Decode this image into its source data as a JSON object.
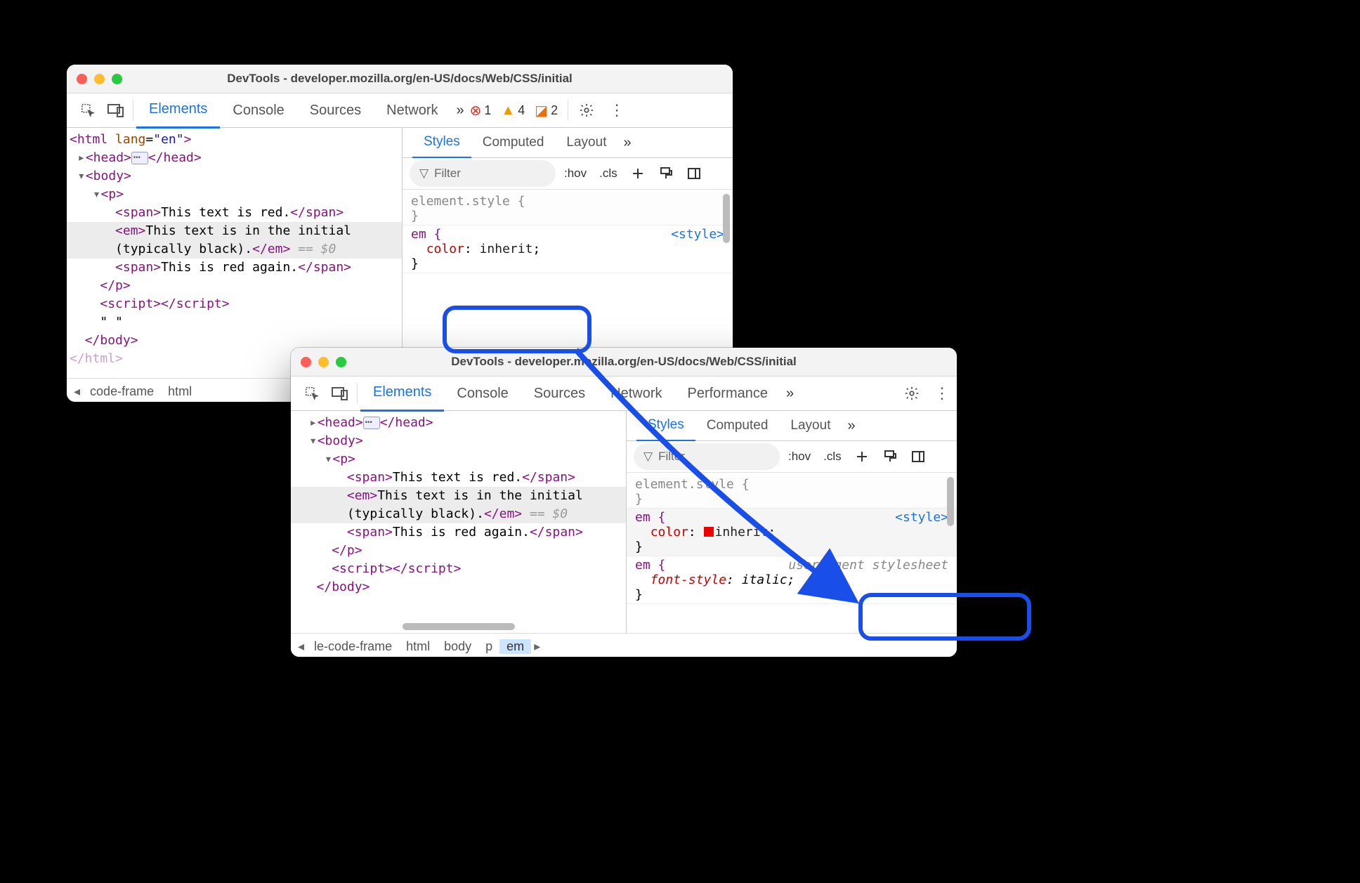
{
  "win1": {
    "title": "DevTools - developer.mozilla.org/en-US/docs/Web/CSS/initial",
    "tabs": {
      "elements": "Elements",
      "console": "Console",
      "sources": "Sources",
      "network": "Network"
    },
    "badges": {
      "errors": "1",
      "warnings": "4",
      "issues": "2"
    },
    "styles": {
      "tabs": {
        "styles": "Styles",
        "computed": "Computed",
        "layout": "Layout"
      },
      "filter": "Filter",
      "hov": ":hov",
      "cls": ".cls",
      "elementStyle": "element.style {",
      "closeBrace": "}",
      "emSelector": "em {",
      "colorProp": "color",
      "colorVal": "inherit",
      "styleLink": "<style>"
    },
    "dom": {
      "htmlOpen": "<html lang=\"en\">",
      "head": "<head>",
      "headClose": "</head>",
      "body": "<body>",
      "bodyClose": "</body>",
      "p": "<p>",
      "pClose": "</p>",
      "span1a": "<span>",
      "span1b": "This text is red.",
      "span1c": "</span>",
      "em1a": "<em>",
      "em1b": "This text is in the initial (typically black).",
      "em1c": "</em>",
      "dollarzero": " == $0",
      "span2a": "<span>",
      "span2b": "This is red again.",
      "span2c": "</span>",
      "script": "<script>",
      "scriptClose": "</script>",
      "quote": "\" \"",
      "htmlClose": "</html>"
    },
    "crumbs": {
      "a": "code-frame",
      "b": "html"
    }
  },
  "win2": {
    "title": "DevTools - developer.mozilla.org/en-US/docs/Web/CSS/initial",
    "tabs": {
      "elements": "Elements",
      "console": "Console",
      "sources": "Sources",
      "network": "Network",
      "performance": "Performance"
    },
    "styles": {
      "tabs": {
        "styles": "Styles",
        "computed": "Computed",
        "layout": "Layout"
      },
      "filter": "Filter",
      "hov": ":hov",
      "cls": ".cls",
      "elementStyle": "element.style {",
      "closeBrace": "}",
      "emSelector": "em {",
      "colorProp": "color",
      "colorVal": "inherit",
      "styleLink": "<style>",
      "uaSelector": "em {",
      "uaProp": "font-style",
      "uaVal": "italic",
      "uaSrc": "user agent stylesheet"
    },
    "dom": {
      "head": "<head>",
      "headClose": "</head>",
      "body": "<body>",
      "bodyClose": "</body>",
      "p": "<p>",
      "pClose": "</p>",
      "span1a": "<span>",
      "span1b": "This text is red.",
      "span1c": "</span>",
      "em1a": "<em>",
      "em1b": "This text is in the initial (typically black).",
      "em1c": "</em>",
      "dollarzero": " == $0",
      "span2a": "<span>",
      "span2b": "This is red again.",
      "span2c": "</span>",
      "script": "<script>",
      "scriptClose": "</script>"
    },
    "crumbs": {
      "a": "le-code-frame",
      "b": "html",
      "c": "body",
      "d": "p",
      "e": "em"
    }
  }
}
